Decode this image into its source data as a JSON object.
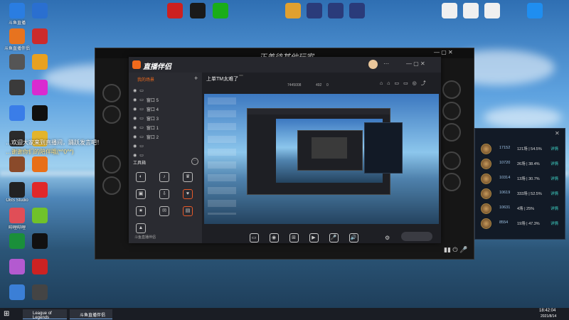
{
  "top_overlay": {
    "banner": "正善待其他玩家"
  },
  "desktop_icons": [
    {
      "label": "斗鱼直播",
      "color": "#2a7de1"
    },
    {
      "label": "斗鱼直播伴侣",
      "color": "#e7731f"
    },
    {
      "label": "",
      "color": "#555"
    },
    {
      "label": "",
      "color": "#3a3a3a"
    },
    {
      "label": "",
      "color": "#3a7de8"
    },
    {
      "label": "",
      "color": "#2b2b2b"
    },
    {
      "label": "",
      "color": "#8a4a2a"
    },
    {
      "label": "OBS Studio",
      "color": "#222"
    },
    {
      "label": "哔哩哔哩",
      "color": "#e04e57"
    },
    {
      "label": "",
      "color": "#1a8f3a"
    },
    {
      "label": "",
      "color": "#b35ad0"
    },
    {
      "label": "",
      "color": "#3b7fd6"
    },
    {
      "label": "",
      "color": "#2a6fd0"
    },
    {
      "label": "",
      "color": "#cc2b2b"
    },
    {
      "label": "",
      "color": "#e8a120"
    },
    {
      "label": "",
      "color": "#d92ad0"
    },
    {
      "label": "",
      "color": "#101010"
    },
    {
      "label": "",
      "color": "#e3b42b"
    },
    {
      "label": "",
      "color": "#e86f18"
    },
    {
      "label": "",
      "color": "#e0282a"
    },
    {
      "label": "",
      "color": "#70c22a"
    },
    {
      "label": "",
      "color": "#111"
    },
    {
      "label": "",
      "color": "#c22"
    },
    {
      "label": "",
      "color": "#444"
    }
  ],
  "top_icons": [
    {
      "label": "",
      "color": "#cc2020"
    },
    {
      "label": "",
      "color": "#1a1a1a"
    },
    {
      "label": "",
      "color": "#1aad19"
    },
    {
      "label": "",
      "color": "#e0a030"
    },
    {
      "label": "",
      "color": "#2a3b7a"
    },
    {
      "label": "",
      "color": "#2a3b7a"
    },
    {
      "label": "",
      "color": "#2a3b7a"
    },
    {
      "label": "",
      "color": "#f0f0f0"
    },
    {
      "label": "",
      "color": "#f0f0f0"
    },
    {
      "label": "",
      "color": "#f0f0f0"
    },
    {
      "label": "",
      "color": "#1f8ef0"
    }
  ],
  "chat": {
    "line1": "…欢迎大家来到直播间，踊跃发言吧！",
    "line2": "…谢谢你们的陪伴哦(*^0^*)"
  },
  "app": {
    "brand": "直播伴侣",
    "side_tabs": [
      "我的场景",
      "",
      ""
    ],
    "tree": [
      "",
      "窗口 5",
      "窗口 4",
      "窗口 3",
      "窗口 1",
      "窗口 2",
      "",
      ""
    ],
    "tools_label": "工具箱",
    "tools": [
      {
        "label": "",
        "icon": "◐"
      },
      {
        "label": "",
        "icon": "♪"
      },
      {
        "label": "",
        "icon": "♛"
      },
      {
        "label": "",
        "icon": "▣"
      },
      {
        "label": "",
        "icon": "⇩"
      },
      {
        "label": "",
        "icon": "♥"
      },
      {
        "label": "",
        "icon": "★"
      },
      {
        "label": "",
        "icon": "✉"
      },
      {
        "label": "",
        "icon": "▤"
      },
      {
        "label": "",
        "icon": "▲"
      }
    ],
    "footer": "斗鱼直播伴侣",
    "title": "上单TM太难了",
    "title_badge": "",
    "room_id": "7445008",
    "hot": "492",
    "fans": "0",
    "bottom_tools": [
      {
        "label": "",
        "icon": "▭"
      },
      {
        "label": "",
        "icon": "◉"
      },
      {
        "label": "",
        "icon": "⊞"
      },
      {
        "label": "",
        "icon": "▶"
      },
      {
        "label": "",
        "icon": "🎤"
      },
      {
        "label": "",
        "icon": "🔊"
      }
    ],
    "start_button": ""
  },
  "ranking": {
    "title": "",
    "rows": [
      {
        "score": "17152",
        "games": "121场 | 54.5%",
        "detail": "详情"
      },
      {
        "score": "10720",
        "games": "26场 | 38.4%",
        "detail": "详情"
      },
      {
        "score": "10314",
        "games": "13场 | 30.7%",
        "detail": "详情"
      },
      {
        "score": "10619",
        "games": "333场 | 52.5%",
        "detail": "详情"
      },
      {
        "score": "10631",
        "games": "4场 | 25%",
        "detail": "详情"
      },
      {
        "score": "8554",
        "games": "19场 | 47.3%",
        "detail": "详情"
      }
    ]
  },
  "taskbar": {
    "apps": [
      "League of Legends",
      "斗鱼直播伴侣"
    ],
    "time": "18:42:04",
    "date": "2021/8/14"
  },
  "colors": {
    "accent": "#e85a2a",
    "teal": "#3ed2c5",
    "brand_orange": "#f06a1c"
  }
}
